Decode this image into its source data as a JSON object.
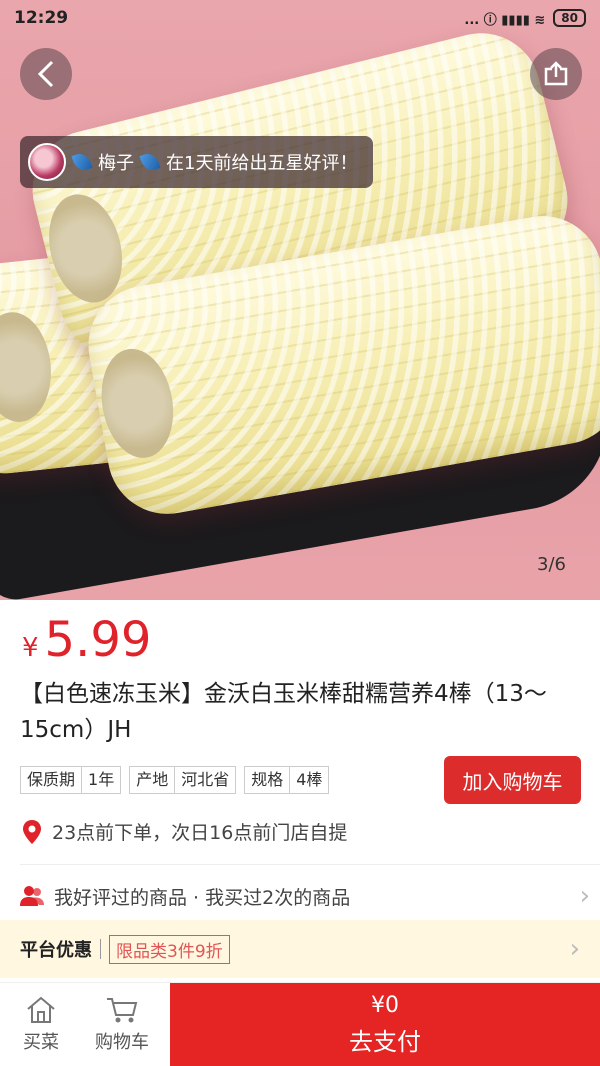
{
  "status_bar": {
    "time": "12:29",
    "battery": "80",
    "indicators": "... ⓘ ▮▮▮▮ ≋"
  },
  "gallery": {
    "indicator": "3/6",
    "image": "white-corn-on-black-tray"
  },
  "review_toast": {
    "user": "梅子",
    "message": "在1天前给出五星好评！"
  },
  "product": {
    "price_symbol": "¥",
    "price": "5.99",
    "title": "【白色速冻玉米】金沃白玉米棒甜糯营养4棒（13～15cm）JH",
    "tags": [
      {
        "name": "保质期",
        "value": "1年"
      },
      {
        "name": "产地",
        "value": "河北省"
      },
      {
        "name": "规格",
        "value": "4棒"
      }
    ],
    "add_to_cart": "加入购物车",
    "delivery": "23点前下单，次日16点前门店自提"
  },
  "history": {
    "text": "我好评过的商品 · 我买过2次的商品"
  },
  "promotion": {
    "label": "平台优惠",
    "offer": "限品类3件9折"
  },
  "bottom_bar": {
    "home_label": "买菜",
    "cart_label": "购物车",
    "pay_amount": "¥0",
    "pay_label": "去支付"
  },
  "colors": {
    "accent": "#e52424",
    "price": "#e0232b",
    "promo_bg": "#fff7e0",
    "hero_bg": "#e9a6ac"
  }
}
